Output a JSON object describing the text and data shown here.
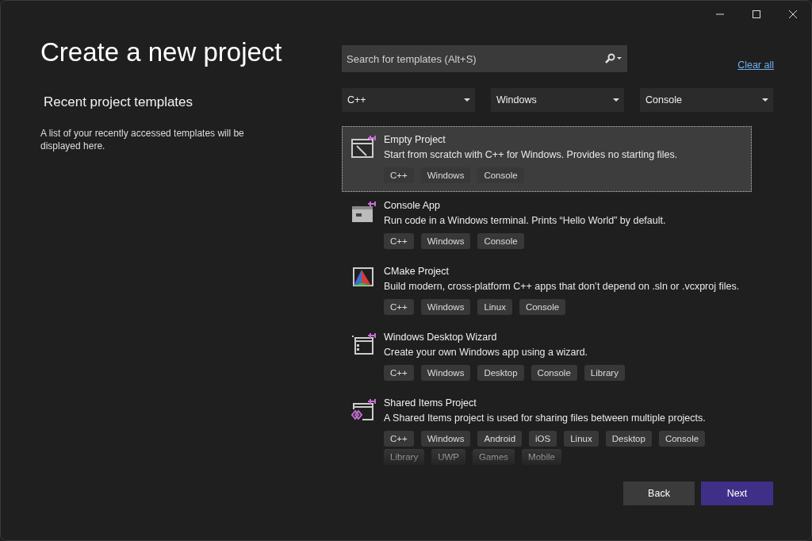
{
  "window": {
    "title": "Create a new project"
  },
  "recent": {
    "heading": "Recent project templates",
    "message": "A list of your recently accessed templates will be displayed here."
  },
  "search": {
    "placeholder": "Search for templates (Alt+S)"
  },
  "clear_all": "Clear all",
  "filters": [
    {
      "value": "C++"
    },
    {
      "value": "Windows"
    },
    {
      "value": "Console"
    }
  ],
  "templates": [
    {
      "kind": "empty",
      "name": "Empty Project",
      "description": "Start from scratch with C++ for Windows. Provides no starting files.",
      "tags": [
        "C++",
        "Windows",
        "Console"
      ],
      "selected": true
    },
    {
      "kind": "console",
      "name": "Console App",
      "description": "Run code in a Windows terminal. Prints “Hello World” by default.",
      "tags": [
        "C++",
        "Windows",
        "Console"
      ],
      "selected": false
    },
    {
      "kind": "cmake",
      "name": "CMake Project",
      "description": "Build modern, cross-platform C++ apps that don’t depend on .sln or .vcxproj files.",
      "tags": [
        "C++",
        "Windows",
        "Linux",
        "Console"
      ],
      "selected": false
    },
    {
      "kind": "wizard",
      "name": "Windows Desktop Wizard",
      "description": "Create your own Windows app using a wizard.",
      "tags": [
        "C++",
        "Windows",
        "Desktop",
        "Console",
        "Library"
      ],
      "selected": false
    },
    {
      "kind": "shared",
      "name": "Shared Items Project",
      "description": "A Shared Items project is used for sharing files between multiple projects.",
      "tags": [
        "C++",
        "Windows",
        "Android",
        "iOS",
        "Linux",
        "Desktop",
        "Console",
        "Library",
        "UWP",
        "Games",
        "Mobile"
      ],
      "selected": false
    }
  ],
  "buttons": [
    {
      "label": "Back",
      "kind": "secondary"
    },
    {
      "label": "Next",
      "kind": "primary"
    }
  ]
}
